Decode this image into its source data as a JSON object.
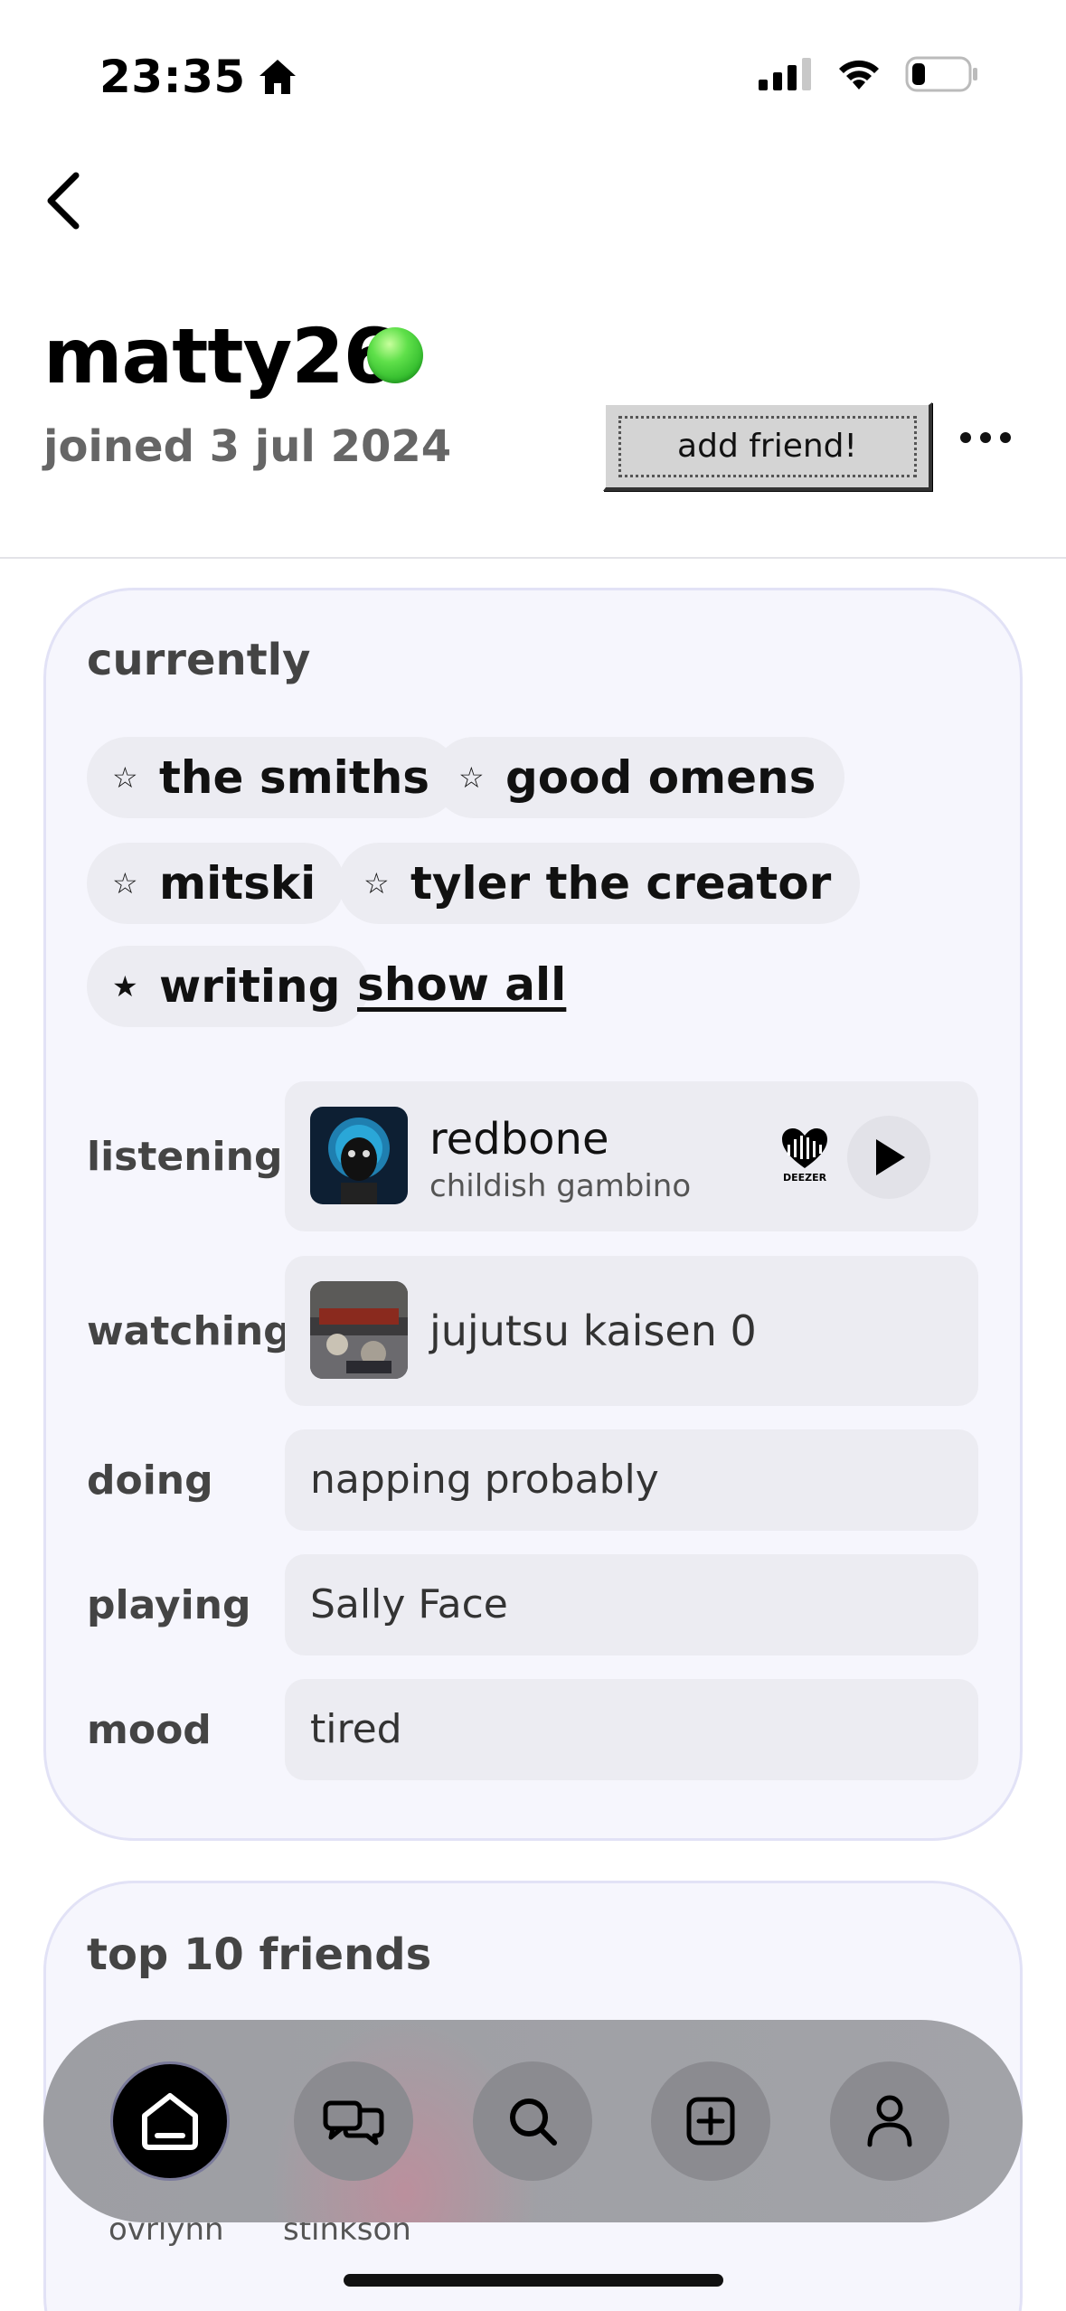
{
  "status_bar": {
    "time": "23:35"
  },
  "profile": {
    "username": "matty26",
    "joined": "joined 3 jul 2024",
    "add_friend_label": "add friend!"
  },
  "currently": {
    "title": "currently",
    "chips": [
      {
        "icon": "star-outline-icon",
        "label": "the smiths"
      },
      {
        "icon": "star-outline-icon",
        "label": "good omens"
      },
      {
        "icon": "star-outline-icon",
        "label": "mitski"
      },
      {
        "icon": "star-outline-icon",
        "label": "tyler the creator"
      },
      {
        "icon": "star-filled-icon",
        "label": "writing"
      }
    ],
    "show_all": "show all",
    "listening": {
      "label": "listening",
      "title": "redbone",
      "artist": "childish gambino",
      "service": "DEEZER"
    },
    "watching": {
      "label": "watching",
      "title": "jujutsu kaisen 0"
    },
    "doing": {
      "label": "doing",
      "value": "napping probably"
    },
    "playing": {
      "label": "playing",
      "value": "Sally Face"
    },
    "mood": {
      "label": "mood",
      "value": "tired"
    }
  },
  "friends": {
    "title": "top 10 friends",
    "names": [
      "ovrlynn",
      "stinkson"
    ]
  },
  "nav": {
    "items": [
      "home-icon",
      "chat-icon",
      "search-icon",
      "add-icon",
      "profile-icon"
    ],
    "active": "home-icon"
  }
}
